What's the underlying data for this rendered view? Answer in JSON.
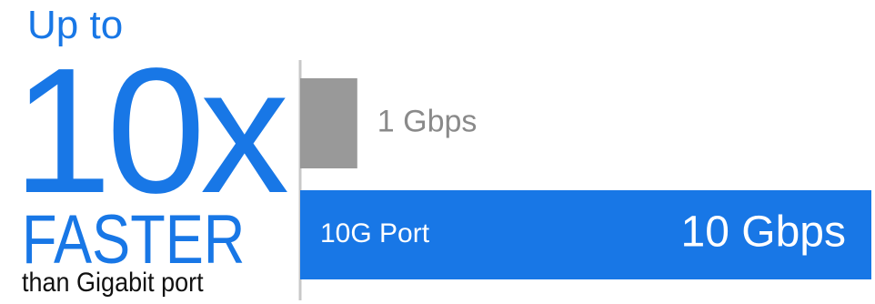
{
  "headline": {
    "line1": "Up to",
    "multiplier": "10x",
    "emphasis": "FASTER",
    "comparison": "than Gigabit port"
  },
  "colors": {
    "accent": "#1877e6",
    "bar_gray": "#999999",
    "label_gray": "#8a8a8a",
    "text_dark": "#111111",
    "white": "#ffffff",
    "axis": "#c8c8c8"
  },
  "chart_data": {
    "type": "bar",
    "orientation": "horizontal",
    "xlim": [
      0,
      10
    ],
    "grid": false,
    "legend": "none",
    "bars": [
      {
        "category": "",
        "value": 1,
        "value_label": "1 Gbps",
        "color": "#999999"
      },
      {
        "category": "10G Port",
        "value": 10,
        "value_label": "10 Gbps",
        "color": "#1877e6"
      }
    ]
  }
}
